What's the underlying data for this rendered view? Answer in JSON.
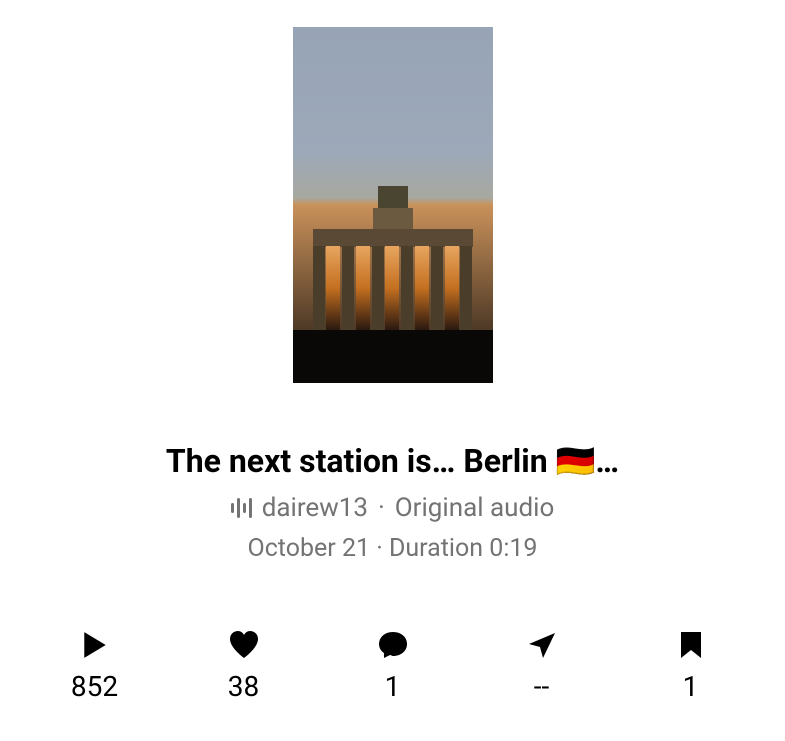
{
  "post": {
    "title": "The next station is… Berlin 🇩🇪…",
    "username": "dairew13",
    "audio_label": "Original audio",
    "date": "October 21",
    "duration_label": "Duration 0:19"
  },
  "stats": {
    "plays": "852",
    "likes": "38",
    "comments": "1",
    "shares": "--",
    "saves": "1"
  }
}
